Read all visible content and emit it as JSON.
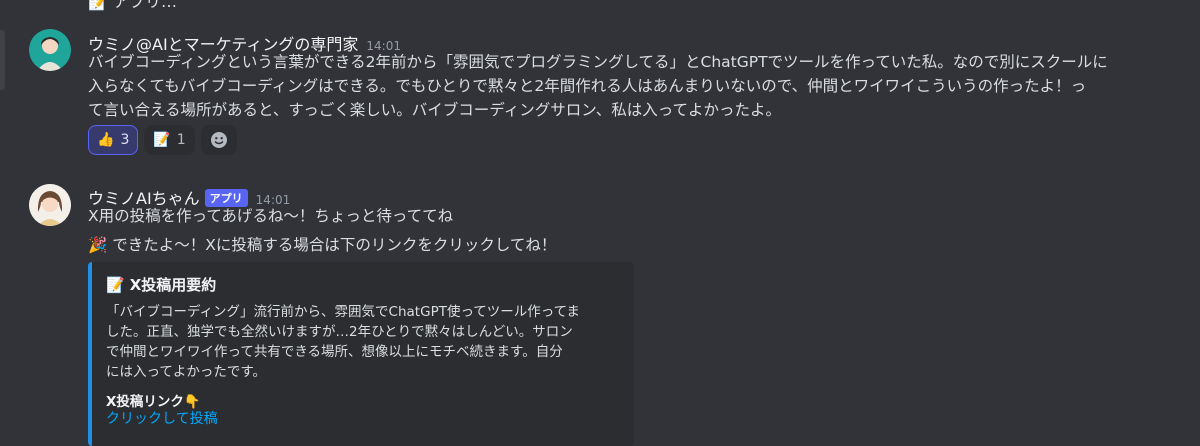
{
  "top_cut_text": "📝 アプリ…",
  "messages": [
    {
      "author": "ウミノ@AIとマーケティングの専門家",
      "time": "14:01",
      "lines": [
        "バイブコーディングという言葉ができる2年前から「雰囲気でプログラミングしてる」とChatGPTでツールを作っていた私。なので別にスクールに",
        "入らなくてもバイブコーディングはできる。でもひとりで黙々と2年間作れる人はあんまりいないので、仲間とワイワイこういうの作ったよ！っ",
        "て言い合える場所があると、すっごく楽しい。バイブコーディングサロン、私は入ってよかったよ。"
      ],
      "reactions": [
        {
          "emoji": "👍",
          "count": "3"
        },
        {
          "emoji": "📝",
          "count": "1"
        }
      ],
      "add_reaction_icon": "emoji-smile-icon"
    },
    {
      "author": "ウミノAIちゃん",
      "badge": "アプリ",
      "time": "14:01",
      "line1": "X用の投稿を作ってあげるね〜！ちょっと待っててね",
      "line2_emoji": "🎉",
      "line2": "できたよ〜！Xに投稿する場合は下のリンクをクリックしてね！",
      "embed": {
        "title_emoji": "📝",
        "title": "X投稿用要約",
        "body_lines": [
          "「バイブコーディング」流行前から、雰囲気でChatGPT使ってツール作ってま",
          "した。正直、独学でも全然いけますが…2年ひとりで黙々はしんどい。サロン",
          "で仲間とワイワイ作って共有できる場所、想像以上にモチベ続きます。自分",
          "には入ってよかったです。"
        ],
        "field_name": "X投稿リンク👇",
        "link_text": "クリックして投稿"
      }
    }
  ]
}
